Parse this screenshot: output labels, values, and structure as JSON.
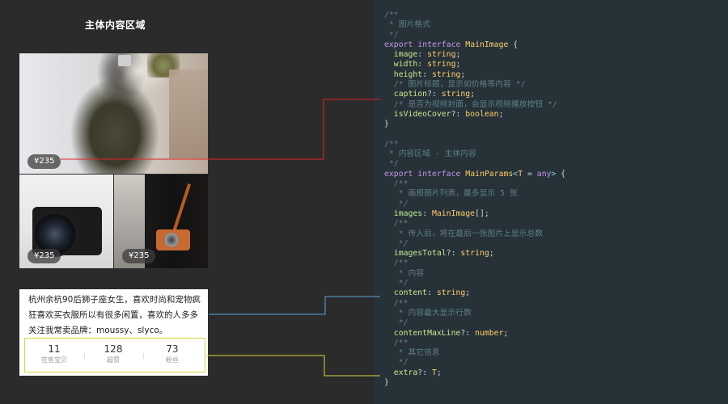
{
  "left": {
    "title": "主体内容区域",
    "prices": [
      "¥235",
      "¥235",
      "¥235"
    ],
    "content_text": "杭州余杭90后狮子座女生，喜欢时尚和宠物疯狂喜欢买衣服所以有很多闲置，喜欢的人多多关注我常卖品牌：moussy、slyco。",
    "stats": [
      {
        "value": "11",
        "label": "在售宝贝"
      },
      {
        "value": "128",
        "label": "超赞"
      },
      {
        "value": "73",
        "label": "粉丝"
      }
    ]
  },
  "code": {
    "lines": [
      [
        [
          "c-com",
          "/**"
        ]
      ],
      [
        [
          "c-com",
          " * 图片格式"
        ]
      ],
      [
        [
          "c-com",
          " */"
        ]
      ],
      [
        [
          "c-kw",
          "export"
        ],
        [
          "",
          " "
        ],
        [
          "c-kw",
          "interface"
        ],
        [
          "",
          " "
        ],
        [
          "c-id",
          "MainImage"
        ],
        [
          "",
          " {"
        ]
      ],
      [
        [
          "",
          "  "
        ],
        [
          "c-prop",
          "image"
        ],
        [
          "",
          ": "
        ],
        [
          "c-ty",
          "string"
        ],
        [
          "",
          ";"
        ]
      ],
      [
        [
          "",
          "  "
        ],
        [
          "c-prop",
          "width"
        ],
        [
          "",
          ": "
        ],
        [
          "c-ty",
          "string"
        ],
        [
          "",
          ";"
        ]
      ],
      [
        [
          "",
          "  "
        ],
        [
          "c-prop",
          "height"
        ],
        [
          "",
          ": "
        ],
        [
          "c-ty",
          "string"
        ],
        [
          "",
          ";"
        ]
      ],
      [
        [
          "",
          "  "
        ],
        [
          "c-com",
          "/* 图片标题，显示如价格等内容 */"
        ]
      ],
      [
        [
          "",
          "  "
        ],
        [
          "c-prop",
          "caption"
        ],
        [
          "",
          "?: "
        ],
        [
          "c-ty",
          "string"
        ],
        [
          "",
          ";"
        ]
      ],
      [
        [
          "",
          "  "
        ],
        [
          "c-com",
          "/* 是否为视频封面，会显示视频播放按钮 */"
        ]
      ],
      [
        [
          "",
          "  "
        ],
        [
          "c-prop",
          "isVideoCover"
        ],
        [
          "",
          "?: "
        ],
        [
          "c-ty",
          "boolean"
        ],
        [
          "",
          ";"
        ]
      ],
      [
        [
          "",
          "}"
        ]
      ],
      [
        [
          "",
          ""
        ]
      ],
      [
        [
          "c-com",
          "/**"
        ]
      ],
      [
        [
          "c-com",
          " * 内容区域 - 主体内容"
        ]
      ],
      [
        [
          "c-com",
          " */"
        ]
      ],
      [
        [
          "c-kw",
          "export"
        ],
        [
          "",
          " "
        ],
        [
          "c-kw",
          "interface"
        ],
        [
          "",
          " "
        ],
        [
          "c-id",
          "MainParams"
        ],
        [
          "c-pun",
          "<"
        ],
        [
          "c-id",
          "T"
        ],
        [
          "",
          " = "
        ],
        [
          "c-kw",
          "any"
        ],
        [
          "c-pun",
          ">"
        ],
        [
          "",
          " {"
        ]
      ],
      [
        [
          "",
          "  "
        ],
        [
          "c-com",
          "/**"
        ]
      ],
      [
        [
          "",
          "  "
        ],
        [
          "c-com",
          " * 画报图片列表，最多显示 5 张"
        ]
      ],
      [
        [
          "",
          "  "
        ],
        [
          "c-com",
          " */"
        ]
      ],
      [
        [
          "",
          "  "
        ],
        [
          "c-prop",
          "images"
        ],
        [
          "",
          ": "
        ],
        [
          "c-id",
          "MainImage"
        ],
        [
          "",
          "[];"
        ]
      ],
      [
        [
          "",
          "  "
        ],
        [
          "c-com",
          "/**"
        ]
      ],
      [
        [
          "",
          "  "
        ],
        [
          "c-com",
          " * 传入后，将在最后一张图片上显示总数"
        ]
      ],
      [
        [
          "",
          "  "
        ],
        [
          "c-com",
          " */"
        ]
      ],
      [
        [
          "",
          "  "
        ],
        [
          "c-prop",
          "imagesTotal"
        ],
        [
          "",
          "?: "
        ],
        [
          "c-ty",
          "string"
        ],
        [
          "",
          ";"
        ]
      ],
      [
        [
          "",
          "  "
        ],
        [
          "c-com",
          "/**"
        ]
      ],
      [
        [
          "",
          "  "
        ],
        [
          "c-com",
          " * 内容"
        ]
      ],
      [
        [
          "",
          "  "
        ],
        [
          "c-com",
          " */"
        ]
      ],
      [
        [
          "",
          "  "
        ],
        [
          "c-prop",
          "content"
        ],
        [
          "",
          ": "
        ],
        [
          "c-ty",
          "string"
        ],
        [
          "",
          ";"
        ]
      ],
      [
        [
          "",
          "  "
        ],
        [
          "c-com",
          "/**"
        ]
      ],
      [
        [
          "",
          "  "
        ],
        [
          "c-com",
          " * 内容最大显示行数"
        ]
      ],
      [
        [
          "",
          "  "
        ],
        [
          "c-com",
          " */"
        ]
      ],
      [
        [
          "",
          "  "
        ],
        [
          "c-prop",
          "contentMaxLine"
        ],
        [
          "",
          "?: "
        ],
        [
          "c-ty",
          "number"
        ],
        [
          "",
          ";"
        ]
      ],
      [
        [
          "",
          "  "
        ],
        [
          "c-com",
          "/**"
        ]
      ],
      [
        [
          "",
          "  "
        ],
        [
          "c-com",
          " * 其它信息"
        ]
      ],
      [
        [
          "",
          "  "
        ],
        [
          "c-com",
          " */"
        ]
      ],
      [
        [
          "",
          "  "
        ],
        [
          "c-prop",
          "extra"
        ],
        [
          "",
          "?: "
        ],
        [
          "c-id",
          "T"
        ],
        [
          "",
          ";"
        ]
      ],
      [
        [
          "",
          "}"
        ]
      ]
    ]
  },
  "colors": {
    "left_bg": "#2b2b2b",
    "code_bg": "#263238",
    "connector_caption": "#e02424",
    "connector_content": "#5aa0d8",
    "connector_extra": "#d6d63a"
  }
}
